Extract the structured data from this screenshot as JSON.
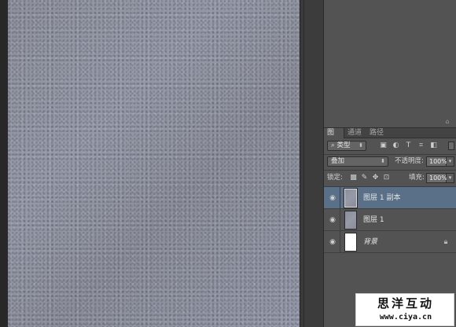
{
  "panel": {
    "tabs": [
      {
        "label": "图层",
        "active": true
      },
      {
        "label": "通道",
        "active": false
      },
      {
        "label": "路径",
        "active": false
      }
    ],
    "filter": {
      "kind_value": "类型",
      "icons": [
        "pixel-filter-icon",
        "adjustment-filter-icon",
        "type-filter-icon",
        "shape-filter-icon",
        "smart-object-filter-icon"
      ]
    },
    "blend_mode": "叠加",
    "opacity_label": "不透明度:",
    "opacity_value": "100%",
    "lock_label": "锁定:",
    "lock_icons": [
      "lock-transparent-icon",
      "lock-paint-icon",
      "lock-position-icon",
      "lock-all-icon"
    ],
    "fill_label": "填充:",
    "fill_value": "100%",
    "layers": [
      {
        "name": "图层 1 副本",
        "selected": true,
        "visible": true,
        "thumbnail": "texture"
      },
      {
        "name": "图层 1",
        "selected": false,
        "visible": true,
        "thumbnail": "texture"
      },
      {
        "name": "背景",
        "selected": false,
        "visible": true,
        "thumbnail": "white",
        "locked": true,
        "italic": true
      }
    ]
  },
  "watermark": {
    "title": "思洋互动",
    "url": "www.ciya.cn"
  },
  "colors": {
    "selected_layer": "#5a7089",
    "panel_bg": "#535353",
    "canvas_texture": "#9195a3"
  }
}
